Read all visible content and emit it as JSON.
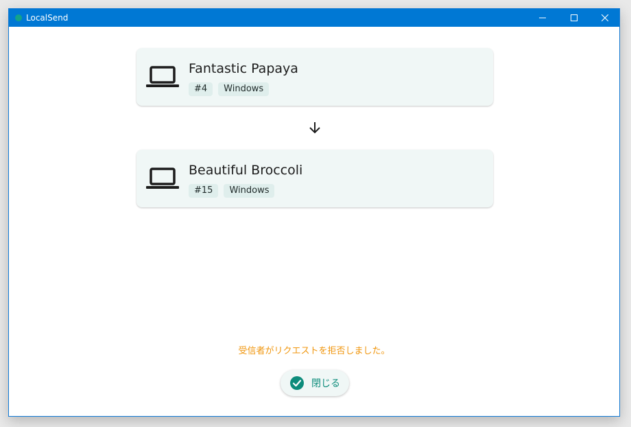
{
  "window": {
    "title": "LocalSend"
  },
  "sender": {
    "name": "Fantastic Papaya",
    "tags": [
      "#4",
      "Windows"
    ]
  },
  "receiver": {
    "name": "Beautiful Broccoli",
    "tags": [
      "#15",
      "Windows"
    ]
  },
  "status": {
    "message": "受信者がリクエストを拒否しました。"
  },
  "actions": {
    "close_label": "閉じる"
  },
  "colors": {
    "titlebar": "#0078d4",
    "accent": "#0d8c7b",
    "warning": "#f0960e",
    "card": "#f0f7f6"
  },
  "icons": {
    "device": "laptop-icon",
    "direction": "arrow-down-icon",
    "action": "check-circle-icon"
  }
}
